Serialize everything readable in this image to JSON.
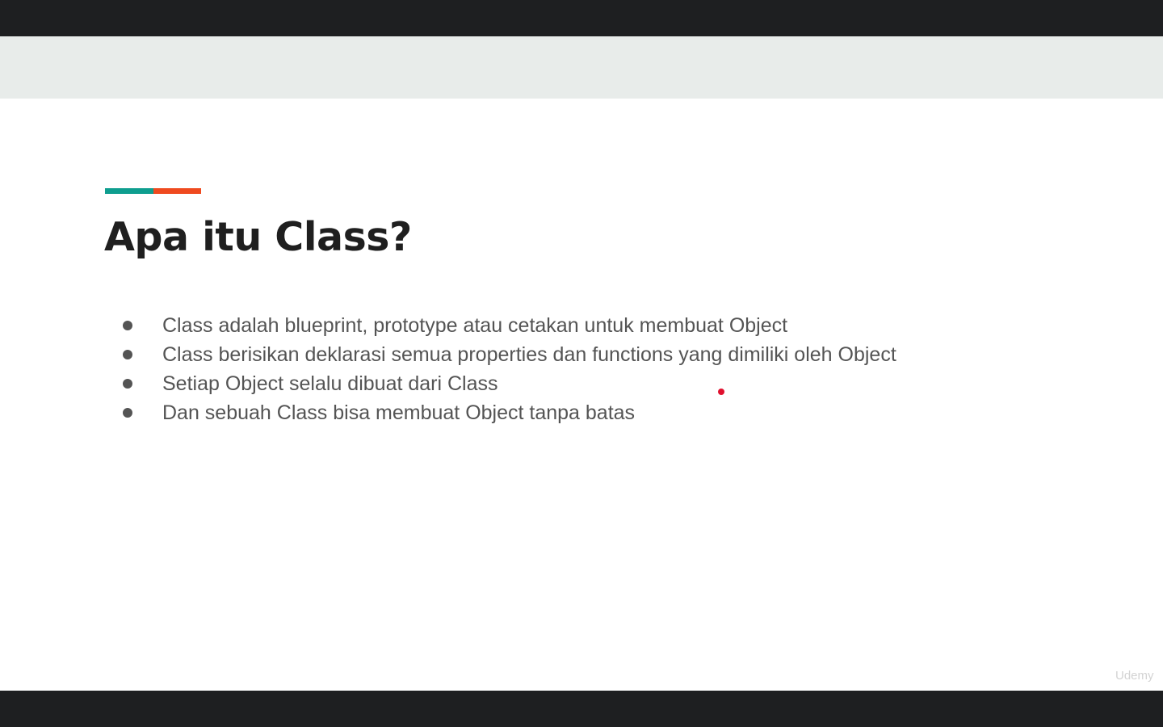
{
  "slide": {
    "title": "Apa itu Class?",
    "bullets": [
      "Class adalah blueprint, prototype atau cetakan untuk membuat Object",
      "Class berisikan deklarasi semua properties dan functions yang dimiliki oleh Object",
      "Setiap Object selalu dibuat dari Class",
      "Dan sebuah Class bisa membuat Object tanpa batas"
    ],
    "accent_colors": [
      "#0e9e8f",
      "#ef4a1f"
    ]
  },
  "player": {
    "watermark": "Udemy",
    "pointer_color": "#e0102e"
  }
}
